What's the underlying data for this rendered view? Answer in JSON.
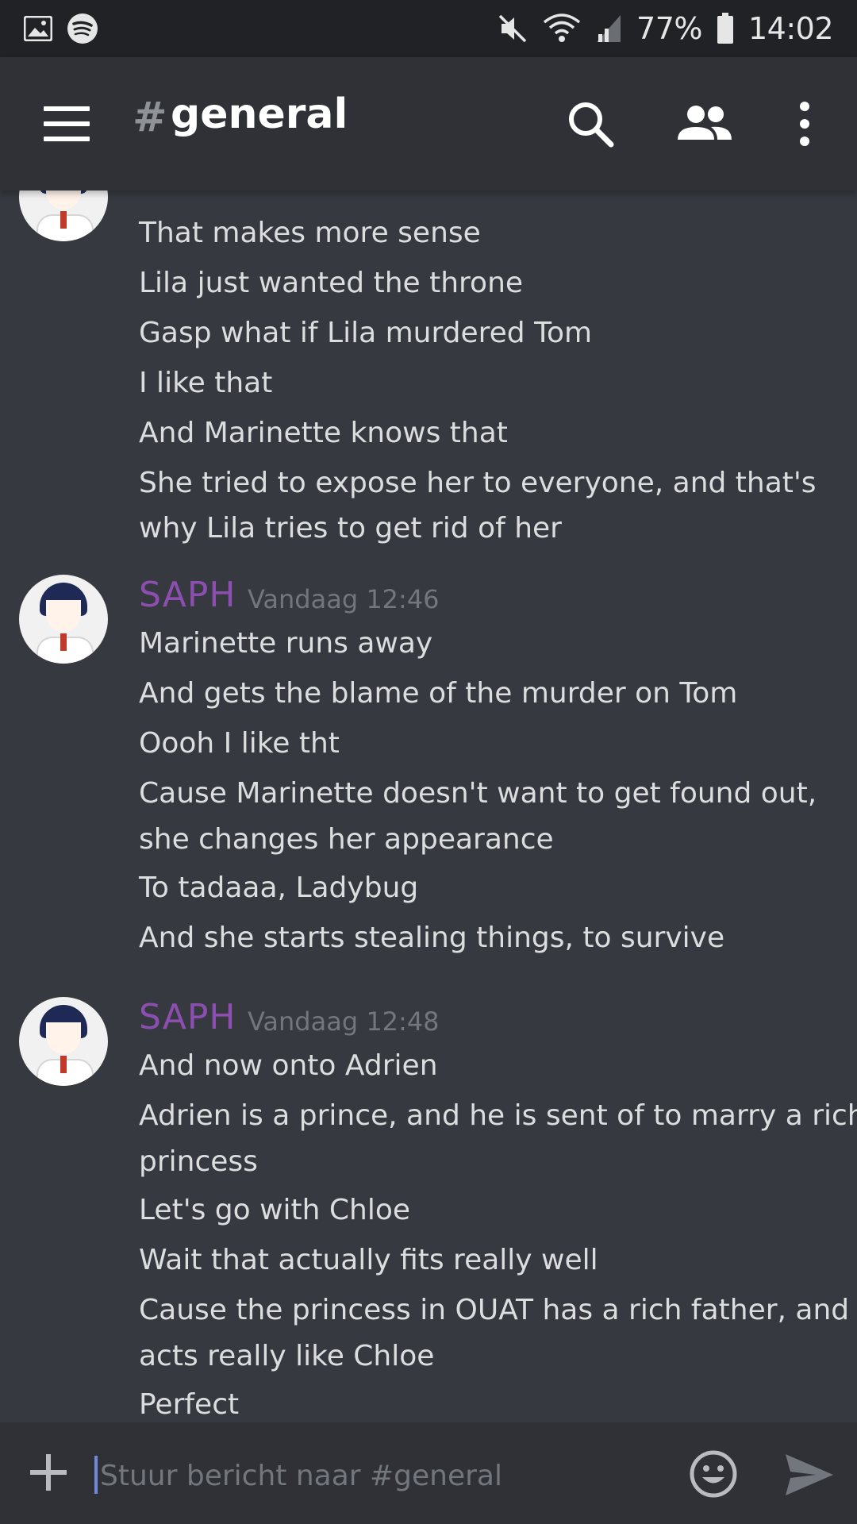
{
  "status_bar": {
    "battery": "77%",
    "time": "14:02"
  },
  "header": {
    "hash": "#",
    "channel_name": "general"
  },
  "messages": {
    "group0": {
      "lines": [
        "That makes more sense",
        "Lila just wanted the throne",
        "Gasp what if Lila murdered Tom",
        "I like that",
        "And Marinette knows that",
        "She tried to expose her to everyone, and that's",
        "why Lila tries to get rid of her"
      ]
    },
    "group1": {
      "author": "SAPH",
      "timestamp": "Vandaag 12:46",
      "lines": [
        "Marinette runs away",
        "And gets the blame of the murder on Tom",
        "Oooh I like tht",
        "Cause Marinette doesn't want to get found out,",
        "she changes her appearance",
        "To tadaaa, Ladybug",
        "And she starts stealing things, to survive"
      ]
    },
    "group2": {
      "author": "SAPH",
      "timestamp": "Vandaag 12:48",
      "lines": [
        "And now onto Adrien",
        "Adrien is a prince, and he is sent of to marry a rich",
        "princess",
        "Let's go with Chloe",
        "Wait that actually fits really well",
        "Cause the princess in OUAT has a rich father, and",
        "acts really like Chloe",
        "Perfect"
      ]
    }
  },
  "composer": {
    "placeholder": "Stuur bericht naar #general"
  },
  "colors": {
    "background": "#36393f",
    "header": "#2f3136",
    "status_bar": "#202225",
    "author": "#8c4fb0",
    "accent": "#7289da"
  },
  "icons": {
    "status_left": [
      "image-icon",
      "spotify-icon"
    ],
    "status_right": [
      "mute-icon",
      "wifi-icon",
      "signal-icon",
      "battery-icon"
    ],
    "header": [
      "menu-icon",
      "search-icon",
      "members-icon",
      "more-vert-icon"
    ],
    "composer": [
      "add-icon",
      "emoji-icon",
      "send-icon"
    ]
  }
}
